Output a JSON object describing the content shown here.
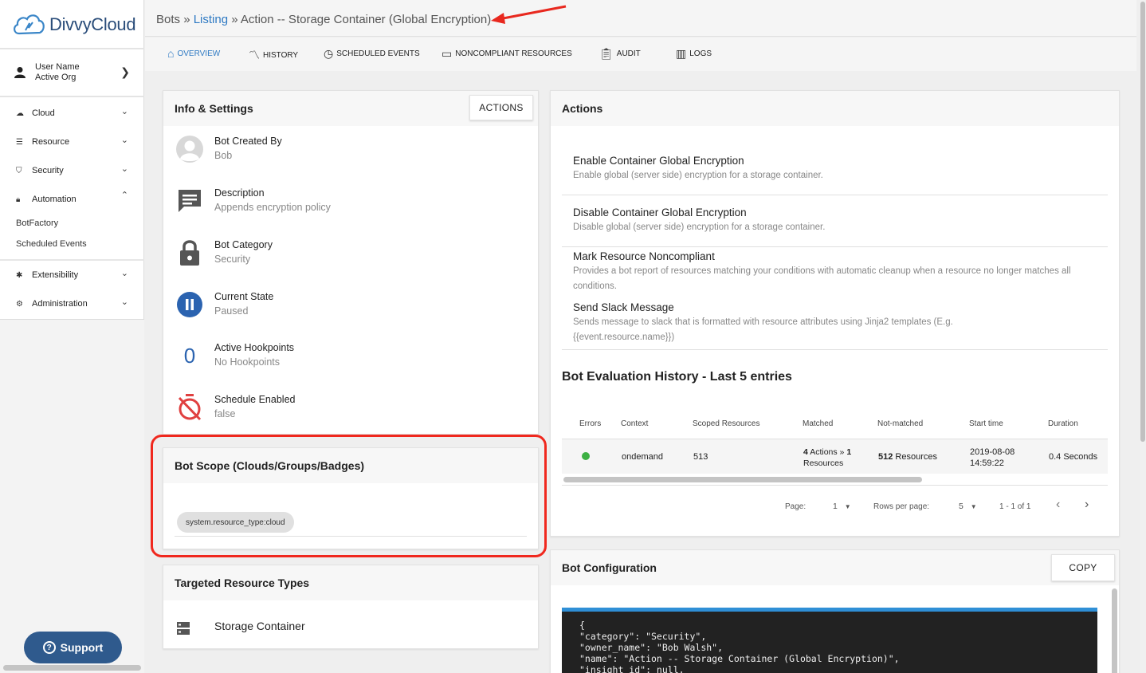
{
  "brand": {
    "name": "DivvyCloud"
  },
  "user": {
    "name": "User Name",
    "org": "Active Org"
  },
  "sidebar": {
    "items": [
      {
        "label": "Cloud",
        "icon": "cloud-icon"
      },
      {
        "label": "Resource",
        "icon": "list-icon"
      },
      {
        "label": "Security",
        "icon": "shield-icon"
      },
      {
        "label": "Automation",
        "icon": "lock-icon"
      },
      {
        "label": "Extensibility",
        "icon": "puzzle-icon"
      },
      {
        "label": "Administration",
        "icon": "gear-icon"
      }
    ],
    "subitems": [
      "BotFactory",
      "Scheduled Events"
    ],
    "support_label": "Support"
  },
  "breadcrumb": {
    "root": "Bots",
    "sep": "»",
    "link": "Listing",
    "current": "Action -- Storage Container (Global Encryption)"
  },
  "tabs": [
    {
      "label": "OVERVIEW",
      "icon": "home-icon"
    },
    {
      "label": "HISTORY",
      "icon": "trend-icon"
    },
    {
      "label": "SCHEDULED EVENTS",
      "icon": "clock-icon"
    },
    {
      "label": "NONCOMPLIANT RESOURCES",
      "icon": "tag-icon"
    },
    {
      "label": "AUDIT",
      "icon": "clipboard-icon"
    },
    {
      "label": "LOGS",
      "icon": "bar-chart-icon"
    }
  ],
  "info": {
    "title": "Info & Settings",
    "actions_label": "ACTIONS",
    "rows": [
      {
        "label": "Bot Created By",
        "value": "Bob"
      },
      {
        "label": "Description",
        "value": "Appends encryption policy"
      },
      {
        "label": "Bot Category",
        "value": "Security"
      },
      {
        "label": "Current State",
        "value": "Paused"
      },
      {
        "label": "Active Hookpoints",
        "value": "No Hookpoints",
        "count": "0"
      },
      {
        "label": "Schedule Enabled",
        "value": "false"
      }
    ]
  },
  "scope": {
    "title": "Bot Scope (Clouds/Groups/Badges)",
    "chip": "system.resource_type:cloud"
  },
  "targeted": {
    "title": "Targeted Resource Types",
    "item": "Storage Container"
  },
  "actions": {
    "title": "Actions",
    "items": [
      {
        "title": "Enable Container Global Encryption",
        "desc": "Enable global (server side) encryption for a storage container."
      },
      {
        "title": "Disable Container Global Encryption",
        "desc": "Disable global (server side) encryption for a storage container."
      },
      {
        "title": "Mark Resource Noncompliant",
        "desc": "Provides a bot report of resources matching your conditions with automatic cleanup when a resource no longer matches all conditions."
      },
      {
        "title": "Send Slack Message",
        "desc": "Sends message to slack that is formatted with resource attributes using Jinja2 templates (E.g. {{event.resource.name}})"
      }
    ]
  },
  "history": {
    "title": "Bot Evaluation History - Last 5 entries",
    "columns": [
      "Errors",
      "Context",
      "Scoped Resources",
      "Matched",
      "Not-matched",
      "Start time",
      "Duration"
    ],
    "row": {
      "status_color": "#3cb043",
      "context": "ondemand",
      "scoped": "513",
      "matched_count": "4",
      "matched_text": "Actions »",
      "matched_count2": "1",
      "matched_text2": "Resources",
      "notmatched_count": "512",
      "notmatched_text": "Resources",
      "start_date": "2019-08-08",
      "start_time": "14:59:22",
      "duration": "0.4 Seconds"
    },
    "pagination": {
      "page_label": "Page:",
      "page": "1",
      "rows_label": "Rows per page:",
      "rows": "5",
      "range": "1 - 1 of 1"
    }
  },
  "config": {
    "title": "Bot Configuration",
    "copy_label": "COPY",
    "lines": [
      "{",
      "\"category\": \"Security\",",
      "\"owner_name\": \"Bob Walsh\",",
      "\"name\": \"Action -- Storage Container (Global Encryption)\",",
      "\"insight_id\": null,"
    ]
  },
  "colors": {
    "accent": "#2f7ac3",
    "brand": "#2f5a8d",
    "highlight": "#f0281e",
    "paused": "#2b63b0"
  }
}
